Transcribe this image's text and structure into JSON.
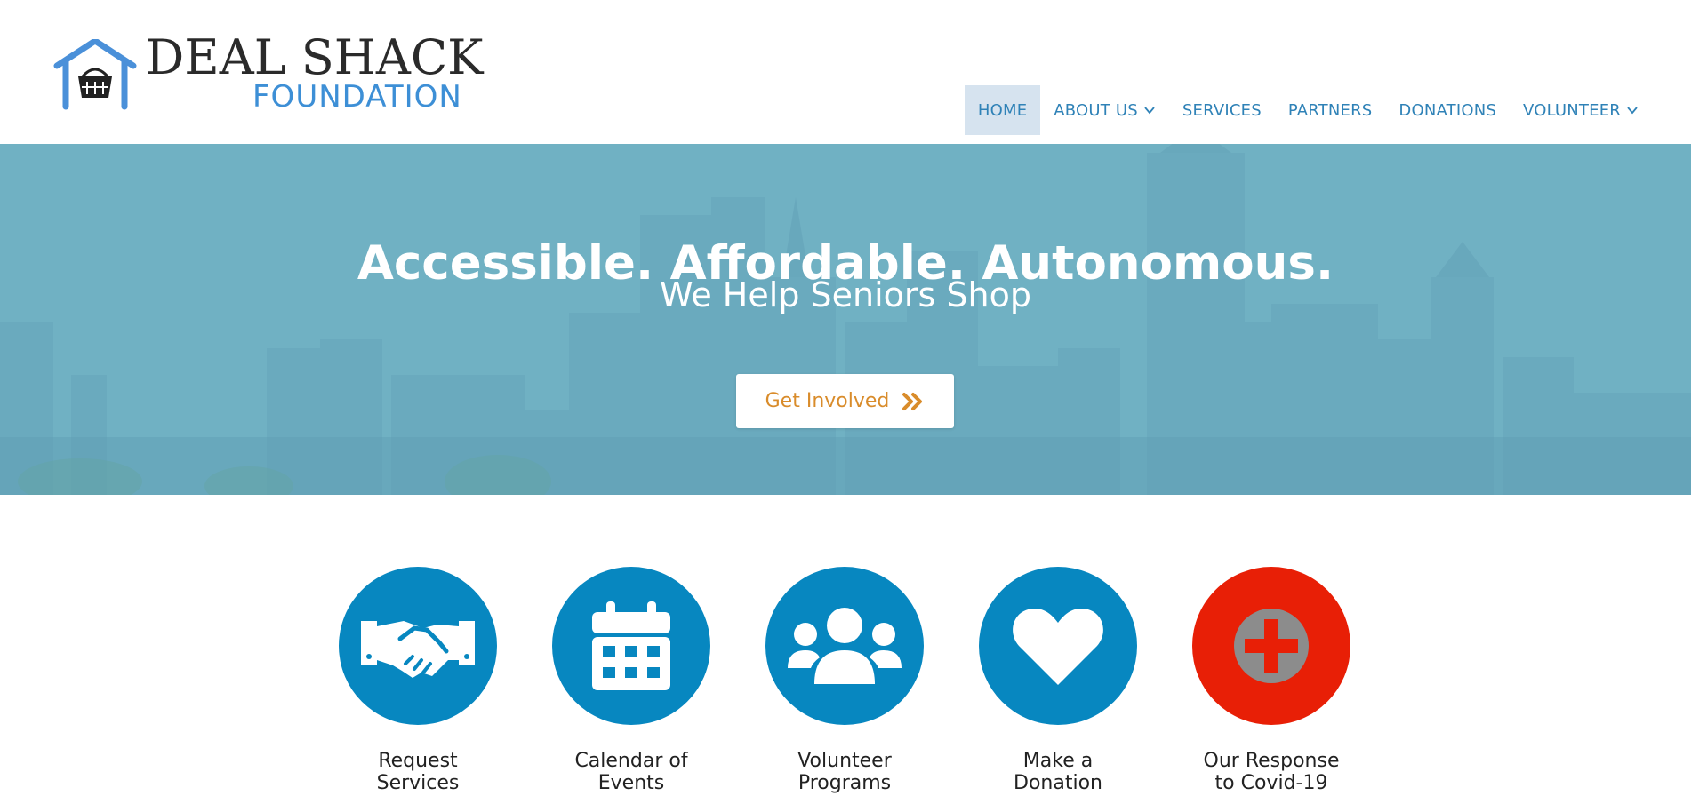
{
  "brand": {
    "name_line1": "DEAL SHACK",
    "name_line2": "FOUNDATION",
    "icon": "house-basket-icon"
  },
  "nav": {
    "items": [
      {
        "label": "HOME",
        "active": true
      },
      {
        "label": "ABOUT US",
        "has_dropdown": true
      },
      {
        "label": "SERVICES"
      },
      {
        "label": "PARTNERS"
      },
      {
        "label": "DONATIONS"
      },
      {
        "label": "VOLUNTEER",
        "has_dropdown": true
      }
    ]
  },
  "hero": {
    "title": "Accessible. Affordable. Autonomous.",
    "subtitle": "We Help Seniors Shop",
    "cta_label": "Get Involved",
    "cta_icon": "double-chevron-right-icon"
  },
  "features": [
    {
      "label": "Request Services",
      "icon": "handshake-icon",
      "color": "#0787c0"
    },
    {
      "label": "Calendar of Events",
      "icon": "calendar-icon",
      "color": "#0787c0"
    },
    {
      "label": "Volunteer Programs",
      "icon": "users-icon",
      "color": "#0787c0"
    },
    {
      "label": "Make a Donation",
      "icon": "heart-icon",
      "color": "#0787c0"
    },
    {
      "label": "Our Response to Covid-19",
      "icon": "medical-cross-icon",
      "color": "#e81f06"
    }
  ],
  "colors": {
    "nav_text": "#2f82b7",
    "nav_active_bg": "#d6e3ef",
    "hero_bg": "#6eafc1",
    "cta_text": "#d98c2b",
    "brand_blue": "#3d8fd6",
    "feature_blue": "#0787c0",
    "feature_red": "#e81f06"
  }
}
